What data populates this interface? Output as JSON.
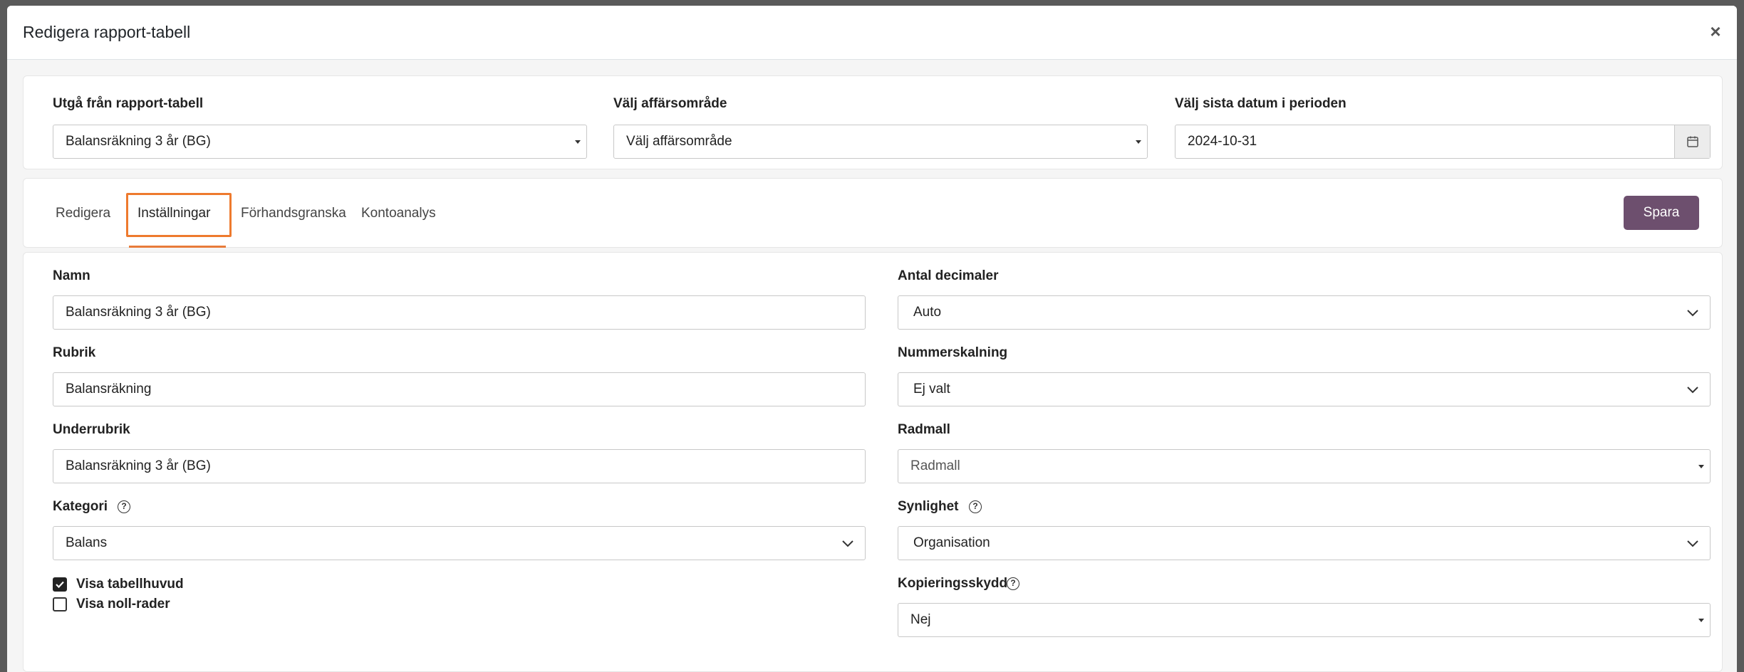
{
  "modal": {
    "title": "Redigera rapport-tabell",
    "close_glyph": "×"
  },
  "top": {
    "source_label": "Utgå från rapport-tabell",
    "source_value": "Balansräkning 3 år (BG)",
    "area_label": "Välj affärsområde",
    "area_value": "Välj affärsområde",
    "date_label": "Välj sista datum i perioden",
    "date_value": "2024-10-31"
  },
  "tabs": [
    {
      "label": "Redigera"
    },
    {
      "label": "Inställningar",
      "active": true
    },
    {
      "label": "Förhandsgranska"
    },
    {
      "label": "Kontoanalys"
    }
  ],
  "save_label": "Spara",
  "settings": {
    "name_label": "Namn",
    "name_value": "Balansräkning 3 år (BG)",
    "heading_label": "Rubrik",
    "heading_value": "Balansräkning",
    "subheading_label": "Underrubrik",
    "subheading_value": "Balansräkning 3 år (BG)",
    "category_label": "Kategori",
    "category_value": "Balans",
    "show_header_label": "Visa tabellhuvud",
    "show_header_checked": true,
    "show_zero_label": "Visa noll-rader",
    "show_zero_checked": false,
    "decimals_label": "Antal decimaler",
    "decimals_value": "Auto",
    "scaling_label": "Nummerskalning",
    "scaling_value": "Ej valt",
    "row_template_label": "Radmall",
    "row_template_value": "Radmall",
    "visibility_label": "Synlighet",
    "visibility_value": "Organisation",
    "copy_protect_label": "Kopieringsskydd",
    "copy_protect_value": "Nej"
  },
  "colors": {
    "accent": "#ee7a2e",
    "save_button": "#6d4f6e"
  }
}
